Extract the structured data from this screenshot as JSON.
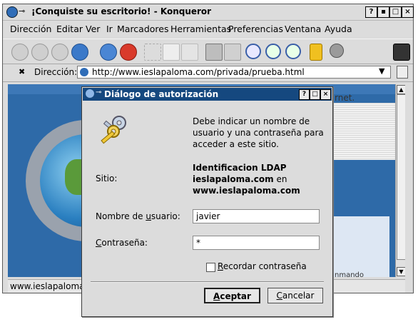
{
  "window": {
    "title": "¡Conquiste su escritorio! - Konqueror",
    "controls": [
      "?",
      "▪",
      "□",
      "×"
    ]
  },
  "menu": [
    {
      "label": "Dirección"
    },
    {
      "label": "Editar"
    },
    {
      "label": "Ver"
    },
    {
      "label": "Ir"
    },
    {
      "label": "Marcadores"
    },
    {
      "label": "Herramientas"
    },
    {
      "label": "Preferencias"
    },
    {
      "label": "Ventana"
    },
    {
      "label": "Ayuda"
    }
  ],
  "location": {
    "label": "Dirección:",
    "url": "http://www.ieslapaloma.com/privada/prueba.html"
  },
  "page": {
    "partial_text_top": "rnet.",
    "partial_text_bottom": "nmando"
  },
  "statusbar": {
    "text": "www.ieslapaloma."
  },
  "dialog": {
    "title": "Diálogo de autorización",
    "controls": [
      "?",
      "□",
      "×"
    ],
    "message": [
      "Debe indicar un nombre de",
      "usuario y una contraseña para",
      "acceder a este sitio."
    ],
    "site_label": "Sitio:",
    "site_line1": "Identificacion LDAP",
    "site_line2_bold": "ieslapaloma.com",
    "site_line2_rest": " en",
    "site_line3": "www.ieslapaloma.com",
    "username_label_pre": "Nombre de ",
    "username_label_u": "u",
    "username_label_post": "suario:",
    "username_value": "javier",
    "password_label_u": "C",
    "password_label_post": "ontraseña:",
    "password_value": "*",
    "remember_u": "R",
    "remember_post": "ecordar contraseña",
    "remember_checked": false,
    "accept_u": "A",
    "accept_post": "ceptar",
    "cancel_u": "C",
    "cancel_post": "ancelar"
  }
}
